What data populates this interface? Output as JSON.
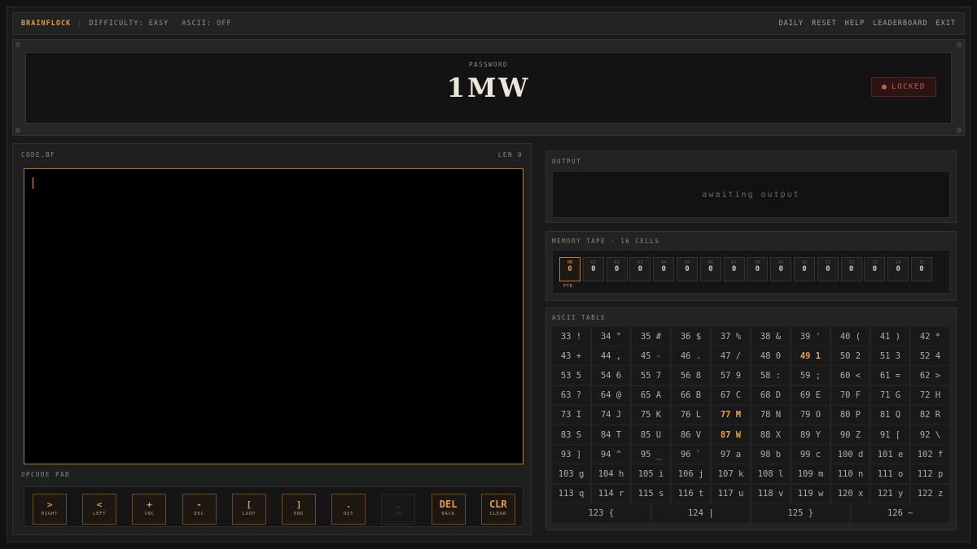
{
  "header": {
    "brand": "BRAINFLOCK",
    "difficulty": "DIFFICULTY: EASY",
    "ascii": "ASCII: OFF",
    "nav": [
      "DAILY",
      "RESET",
      "HELP",
      "LEADERBOARD",
      "EXIT"
    ]
  },
  "password": {
    "label": "PASSWORD",
    "value": "1MW",
    "status": "LOCKED"
  },
  "code": {
    "label": "CODE.BF",
    "length": "LEN 0",
    "pad_label": "OPCODE PAD"
  },
  "keys": [
    {
      "sym": ">",
      "label": "RIGHT",
      "enabled": true
    },
    {
      "sym": "<",
      "label": "LEFT",
      "enabled": true
    },
    {
      "sym": "+",
      "label": "INC",
      "enabled": true
    },
    {
      "sym": "-",
      "label": "DEC",
      "enabled": true
    },
    {
      "sym": "[",
      "label": "LOOP",
      "enabled": true
    },
    {
      "sym": "]",
      "label": "END",
      "enabled": true
    },
    {
      "sym": ".",
      "label": "OUT",
      "enabled": true
    },
    {
      "sym": ",",
      "label": "IN",
      "enabled": false
    },
    {
      "sym": "DEL",
      "label": "BACK",
      "enabled": true
    },
    {
      "sym": "CLR",
      "label": "CLEAR",
      "enabled": true
    }
  ],
  "output": {
    "label": "OUTPUT",
    "placeholder": "awaiting output"
  },
  "tape": {
    "label": "MEMORY TAPE · 16 CELLS",
    "pointer_label": "PTR",
    "active_index": 0,
    "cells": [
      {
        "index": "00",
        "value": "0"
      },
      {
        "index": "01",
        "value": "0"
      },
      {
        "index": "02",
        "value": "0"
      },
      {
        "index": "03",
        "value": "0"
      },
      {
        "index": "04",
        "value": "0"
      },
      {
        "index": "05",
        "value": "0"
      },
      {
        "index": "06",
        "value": "0"
      },
      {
        "index": "07",
        "value": "0"
      },
      {
        "index": "08",
        "value": "0"
      },
      {
        "index": "09",
        "value": "0"
      },
      {
        "index": "10",
        "value": "0"
      },
      {
        "index": "11",
        "value": "0"
      },
      {
        "index": "12",
        "value": "0"
      },
      {
        "index": "13",
        "value": "0"
      },
      {
        "index": "14",
        "value": "0"
      },
      {
        "index": "15",
        "value": "0"
      }
    ]
  },
  "ascii_table": {
    "label": "ASCII TABLE",
    "highlighted": [
      "49",
      "77",
      "87"
    ],
    "entries": [
      "33 !",
      "34 \"",
      "35 #",
      "36 $",
      "37 %",
      "38 &",
      "39 '",
      "40 (",
      "41 )",
      "42 *",
      "43 +",
      "44 ,",
      "45 -",
      "46 .",
      "47 /",
      "48 0",
      "49 1",
      "50 2",
      "51 3",
      "52 4",
      "53 5",
      "54 6",
      "55 7",
      "56 8",
      "57 9",
      "58 :",
      "59 ;",
      "60 <",
      "61 =",
      "62 >",
      "63 ?",
      "64 @",
      "65 A",
      "66 B",
      "67 C",
      "68 D",
      "69 E",
      "70 F",
      "71 G",
      "72 H",
      "73 I",
      "74 J",
      "75 K",
      "76 L",
      "77 M",
      "78 N",
      "79 O",
      "80 P",
      "81 Q",
      "82 R",
      "83 S",
      "84 T",
      "85 U",
      "86 V",
      "87 W",
      "88 X",
      "89 Y",
      "90 Z",
      "91 [",
      "92 \\",
      "93 ]",
      "94 ^",
      "95 _",
      "96 `",
      "97 a",
      "98 b",
      "99 c",
      "100 d",
      "101 e",
      "102 f",
      "103 g",
      "104 h",
      "105 i",
      "106 j",
      "107 k",
      "108 l",
      "109 m",
      "110 n",
      "111 o",
      "112 p",
      "113 q",
      "114 r",
      "115 s",
      "116 t",
      "117 u",
      "118 v",
      "119 w",
      "120 x",
      "121 y",
      "122 z",
      "123 {",
      "124 |",
      "125 }",
      "126 ~"
    ]
  },
  "colors": {
    "accent": "#e69a3a",
    "locked": "#d25a4a",
    "panel": "#232323",
    "background": "#111111"
  }
}
